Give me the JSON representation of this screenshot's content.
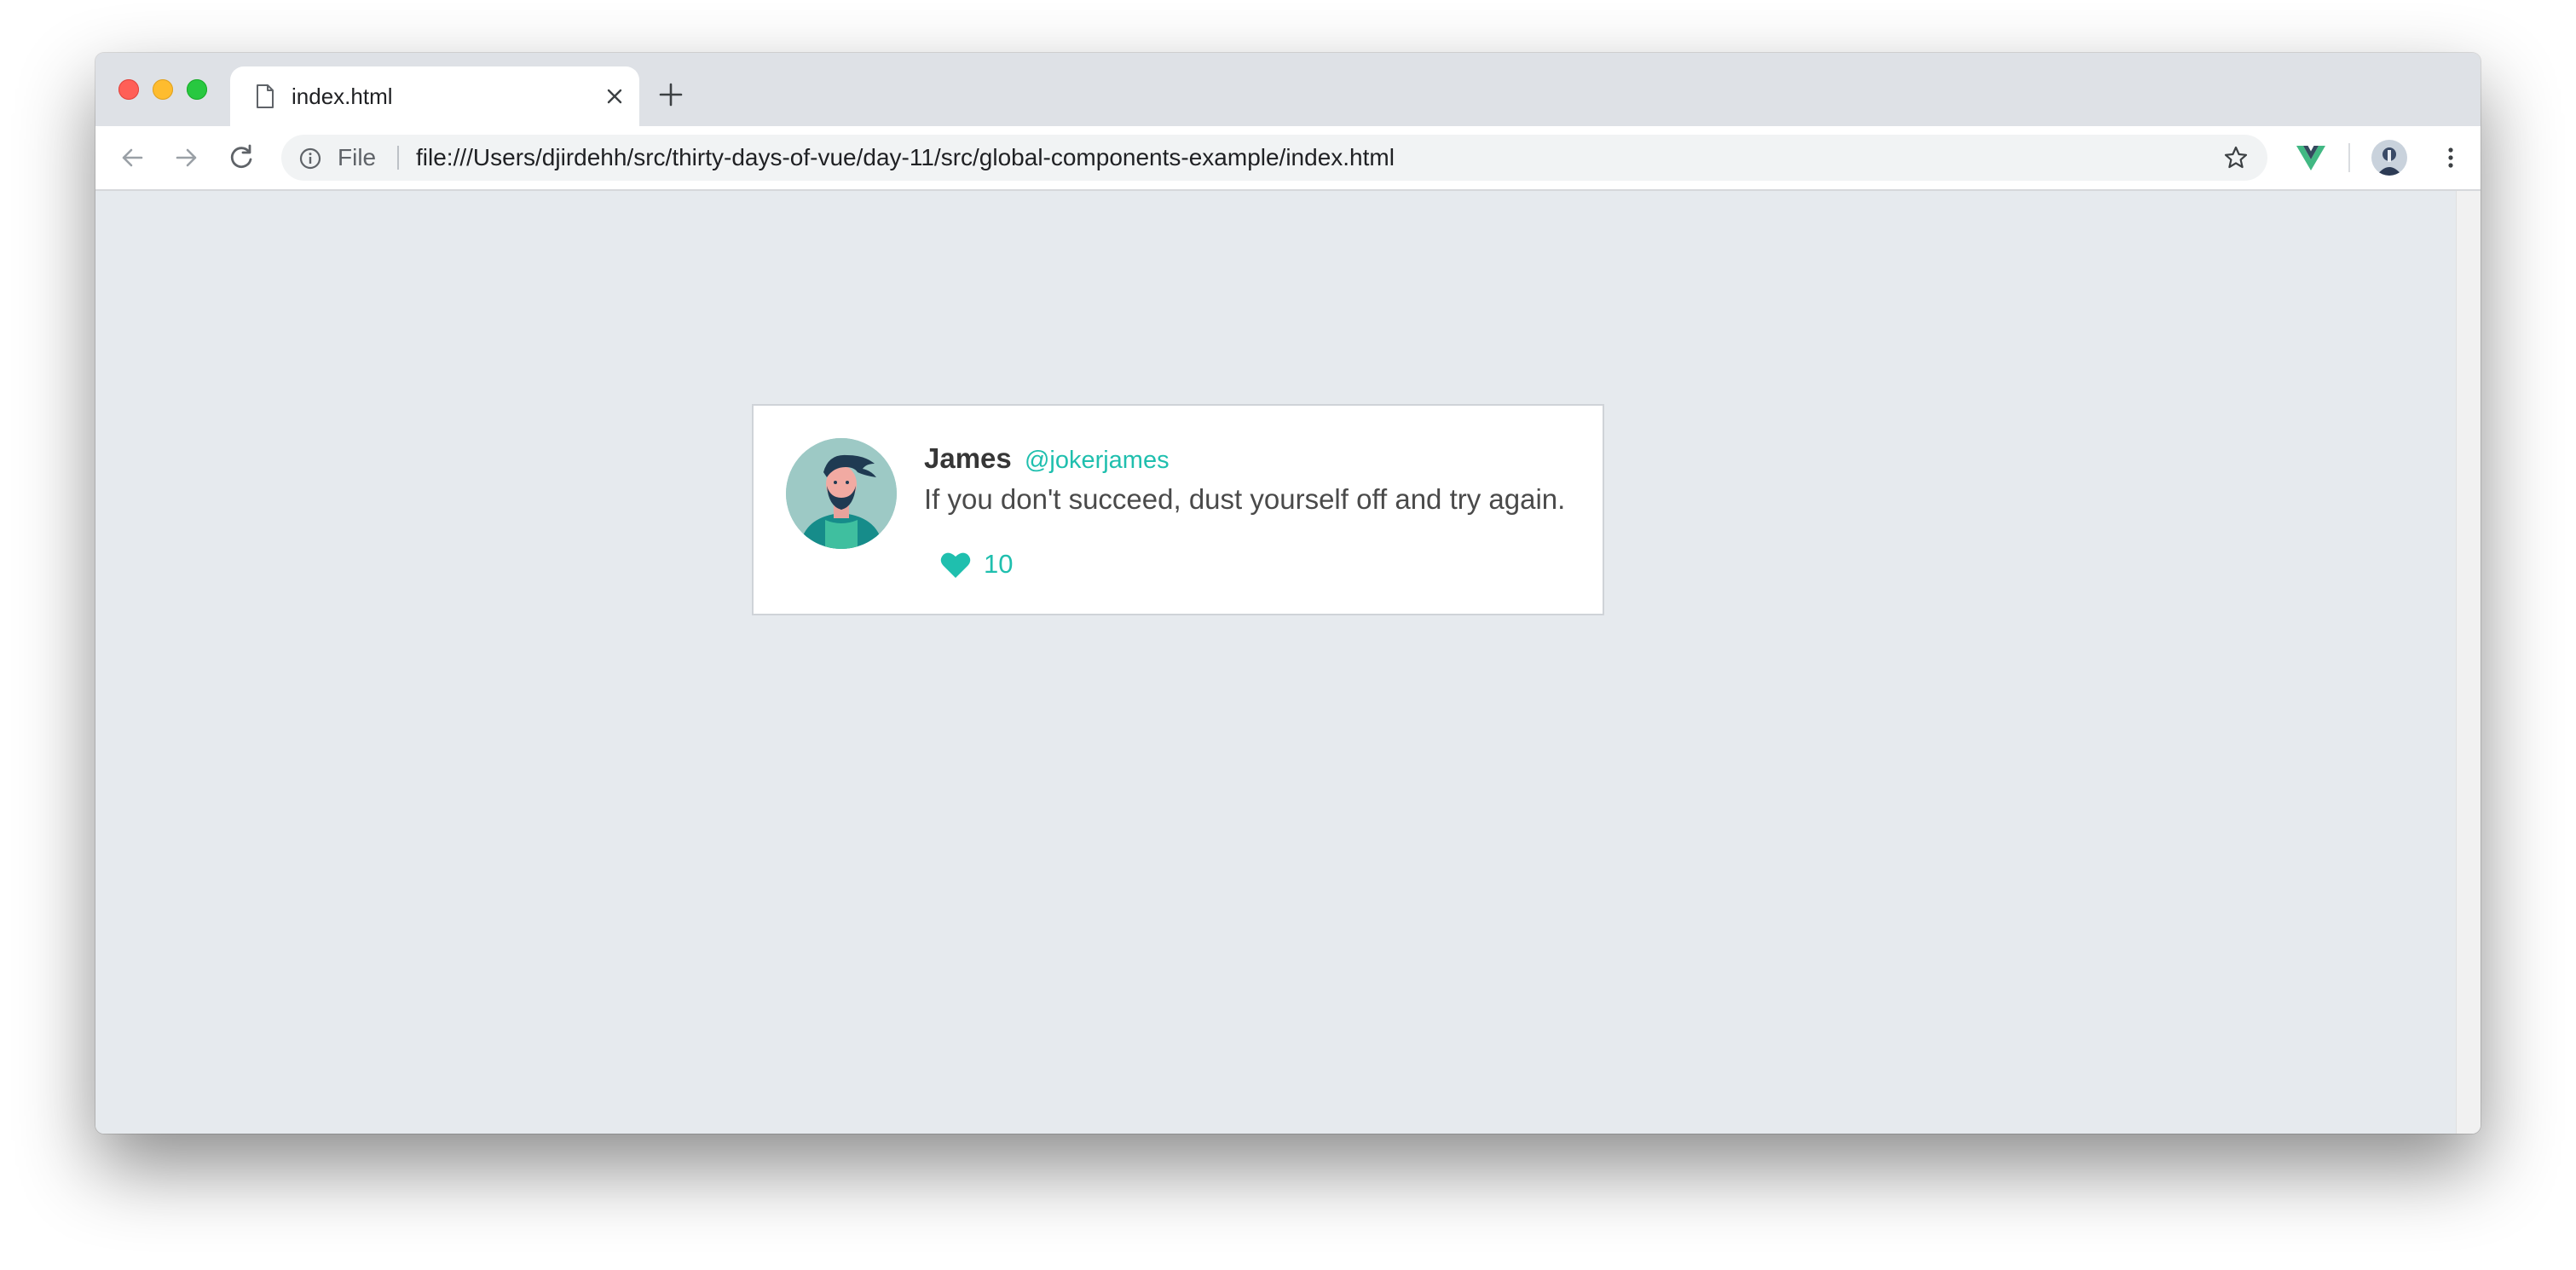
{
  "browser": {
    "tab": {
      "title": "index.html",
      "icon": "document-icon"
    },
    "omnibox": {
      "scheme_label": "File",
      "url": "file:///Users/djirdehh/src/thirty-days-of-vue/day-11/src/global-components-example/index.html"
    },
    "extensions": [
      "vue-devtools-icon"
    ],
    "colors": {
      "tabstrip": "#dee1e6",
      "page_background": "#e6eaee"
    }
  },
  "tweet": {
    "name": "James",
    "handle": "@jokerjames",
    "message": "If you don't succeed, dust yourself off and try again.",
    "likes": "10",
    "accent_color": "#1fbfae"
  }
}
